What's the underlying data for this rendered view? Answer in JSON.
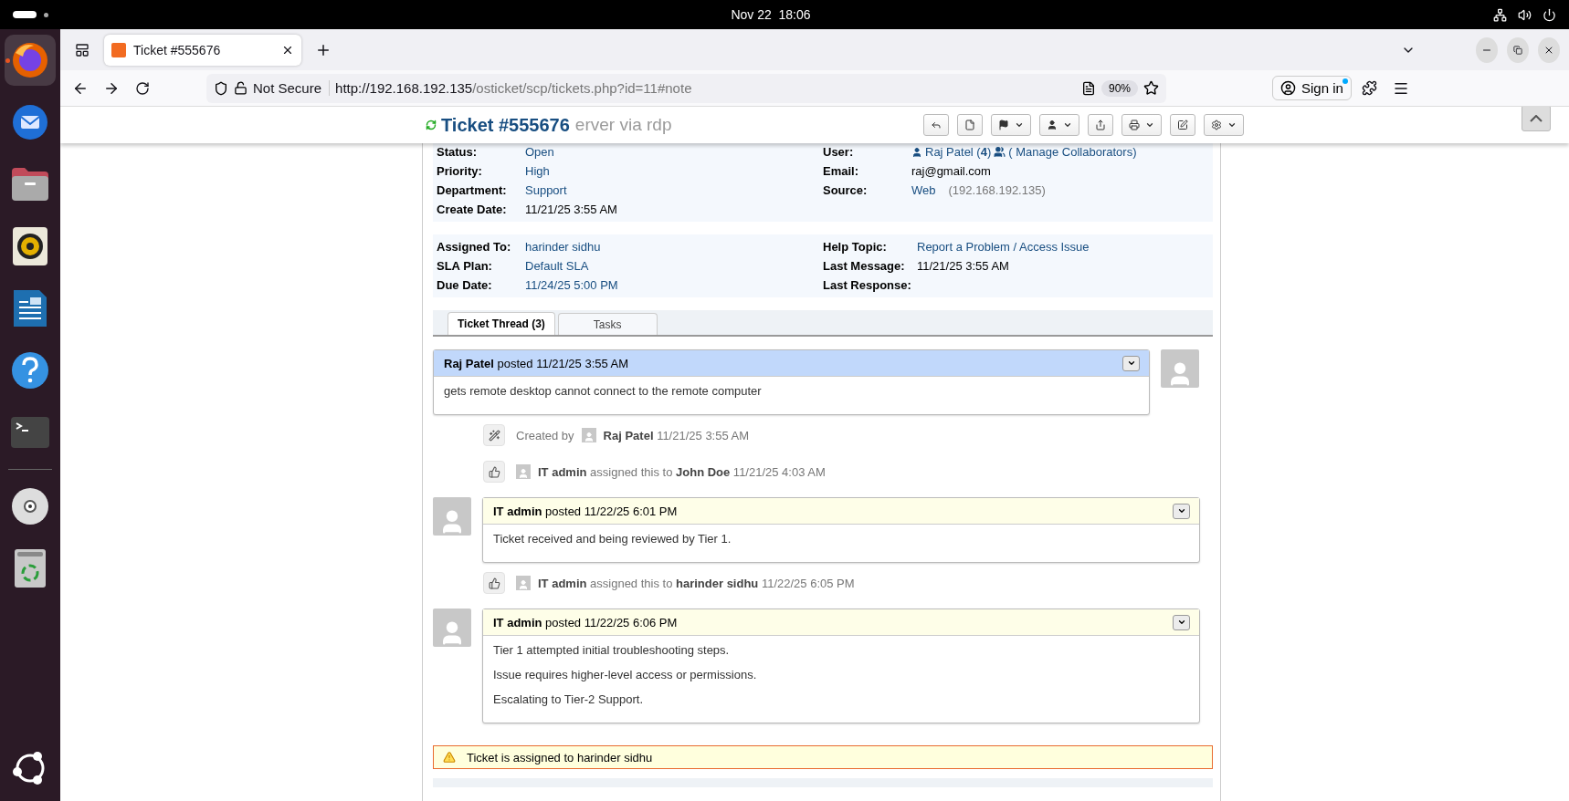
{
  "top_bar": {
    "date": "Nov 22",
    "time": "18:06"
  },
  "dock": {
    "items": [
      {
        "kind": "firefox",
        "running": true
      },
      {
        "kind": "mail"
      },
      {
        "kind": "files"
      },
      {
        "kind": "speaker"
      },
      {
        "kind": "writer"
      },
      {
        "kind": "help"
      },
      {
        "kind": "terminal"
      },
      {
        "kind": "disc"
      },
      {
        "kind": "trash"
      }
    ]
  },
  "browser": {
    "tabs": [
      {
        "title": "Ticket #555676",
        "selected": true
      }
    ],
    "security": "Not Secure",
    "url_host": "http://192.168.192.135",
    "url_path": "/osticket/scp/tickets.php?id=11#note",
    "zoom": "90%",
    "sign_in": "Sign in"
  },
  "ticket": {
    "title": "Ticket #555676",
    "subject_fragment": "erver via rdp",
    "actions": [
      {
        "kind": "reply",
        "dropdown": false
      },
      {
        "kind": "note",
        "dropdown": false
      },
      {
        "kind": "flag",
        "dropdown": true
      },
      {
        "kind": "user",
        "dropdown": true
      },
      {
        "kind": "share",
        "dropdown": false
      },
      {
        "kind": "print",
        "dropdown": true
      },
      {
        "kind": "edit",
        "dropdown": false
      },
      {
        "kind": "settings",
        "dropdown": true
      }
    ],
    "info_sections": [
      {
        "left": [
          {
            "label": "Status:",
            "kind": "link",
            "value": "Open"
          },
          {
            "label": "Priority:",
            "kind": "link",
            "value": "High"
          },
          {
            "label": "Department:",
            "kind": "link",
            "value": "Support"
          },
          {
            "label": "Create Date:",
            "kind": "text",
            "value": "11/21/25 3:55 AM"
          }
        ],
        "right": [
          {
            "label": "User:",
            "kind": "user",
            "value": "Raj Patel (**4**)",
            "extra": "( Manage Collaborators)"
          },
          {
            "label": "Email:",
            "kind": "text",
            "value": "raj@gmail.com"
          },
          {
            "label": "Source:",
            "kind": "source",
            "value": "Web",
            "extra": "(192.168.192.135)"
          }
        ]
      },
      {
        "left": [
          {
            "label": "Assigned To:",
            "kind": "link",
            "value": "harinder sidhu"
          },
          {
            "label": "SLA Plan:",
            "kind": "link",
            "value": "Default SLA"
          },
          {
            "label": "Due Date:",
            "kind": "link",
            "value": "11/24/25 5:00 PM"
          }
        ],
        "right": [
          {
            "label": "Help Topic:",
            "kind": "link",
            "value": "Report a Problem / Access Issue"
          },
          {
            "label": "Last Message:",
            "kind": "text",
            "value": "11/21/25 3:55 AM"
          },
          {
            "label": "Last Response:",
            "kind": "empty"
          }
        ]
      }
    ],
    "tabs": [
      {
        "label": "Ticket Thread (3)",
        "selected": true
      },
      {
        "label": "Tasks",
        "selected": false
      }
    ],
    "thread": [
      {
        "kind": "user_message",
        "header": "**Raj Patel** posted 11/21/25 3:55 AM",
        "body": [
          "gets remote desktop cannot connect to the remote computer"
        ]
      },
      {
        "kind": "created",
        "prefix": "Created by",
        "text": "**Raj Patel** 11/21/25 3:55 AM"
      },
      {
        "kind": "assigned",
        "text": "**IT admin** assigned this to **John Doe** 11/21/25 4:03 AM"
      },
      {
        "kind": "staff_message",
        "header": "**IT admin** posted 11/22/25 6:01 PM",
        "body": [
          "Ticket received and being reviewed by Tier 1."
        ]
      },
      {
        "kind": "assigned",
        "text": "**IT admin** assigned this to **harinder sidhu** 11/22/25 6:05 PM"
      },
      {
        "kind": "staff_message",
        "header": "**IT admin** posted 11/22/25 6:06 PM",
        "body": [
          "Tier 1 attempted initial troubleshooting steps.",
          "Issue requires higher-level access or permissions.",
          "Escalating to Tier-2 Support."
        ]
      }
    ],
    "alert": {
      "kind": "warning",
      "text": "Ticket is assigned to harinder sidhu"
    }
  }
}
